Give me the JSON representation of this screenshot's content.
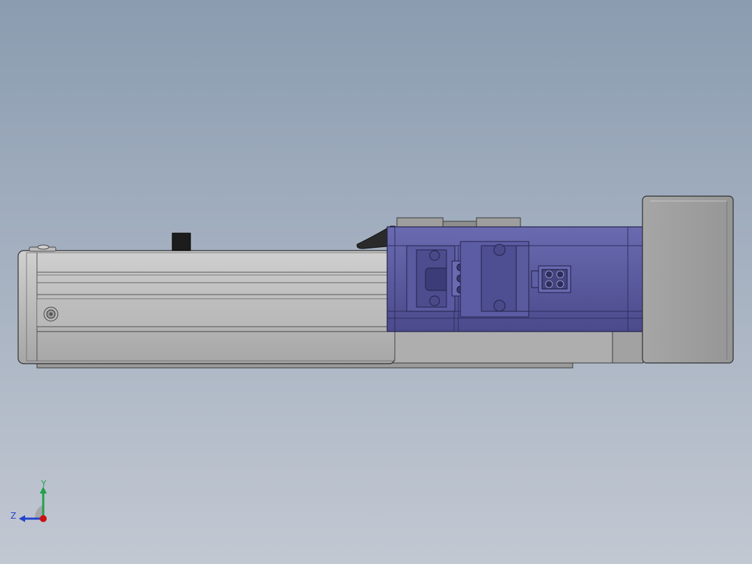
{
  "viewport": {
    "background_top": "#8a9cb0",
    "background_bottom": "#c2c8d2"
  },
  "model": {
    "rail_color": "#b4b4b4",
    "motor_color": "#55559a",
    "motor_end_color": "#9e9e9e",
    "block_color": "#1a1a1a"
  },
  "triad": {
    "y_label": "Y",
    "z_label": "Z",
    "y_color": "#22a04a",
    "z_color": "#2244cc",
    "x_color": "#cc1111"
  }
}
